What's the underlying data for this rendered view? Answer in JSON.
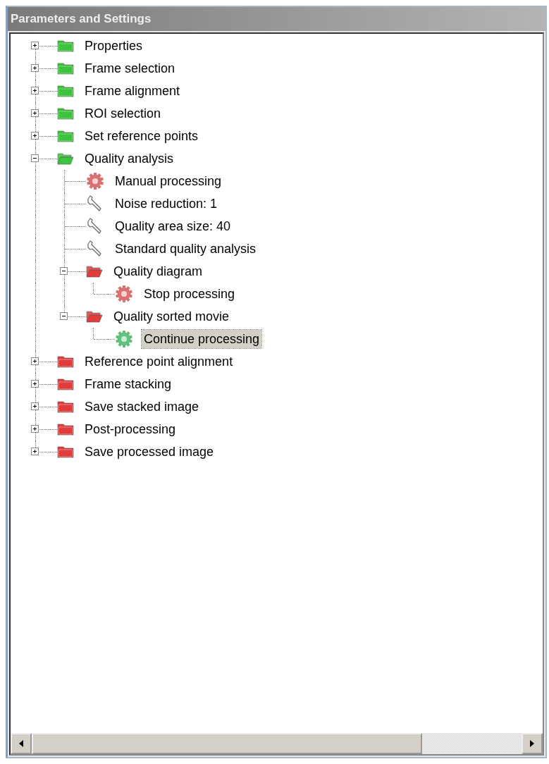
{
  "panel": {
    "title": "Parameters and Settings"
  },
  "nodes": [
    {
      "label": "Properties",
      "kind": "folder",
      "color": "#3cc43c",
      "expanded": false,
      "selected": false
    },
    {
      "label": "Frame selection",
      "kind": "folder",
      "color": "#3cc43c",
      "expanded": false,
      "selected": false
    },
    {
      "label": "Frame alignment",
      "kind": "folder",
      "color": "#3cc43c",
      "expanded": false,
      "selected": false
    },
    {
      "label": "ROI selection",
      "kind": "folder",
      "color": "#3cc43c",
      "expanded": false,
      "selected": false
    },
    {
      "label": "Set reference points",
      "kind": "folder",
      "color": "#3cc43c",
      "expanded": false,
      "selected": false
    },
    {
      "label": "Quality analysis",
      "kind": "folder",
      "color": "#3cc43c",
      "expanded": true,
      "selected": false,
      "children": [
        {
          "label": "Manual processing",
          "kind": "gear",
          "color": "#e07070",
          "selected": false
        },
        {
          "label": "Noise reduction: 1",
          "kind": "wrench",
          "selected": false
        },
        {
          "label": "Quality area size: 40",
          "kind": "wrench",
          "selected": false
        },
        {
          "label": "Standard quality analysis",
          "kind": "wrench",
          "selected": false
        },
        {
          "label": "Quality diagram",
          "kind": "folder",
          "color": "#e03c3c",
          "expanded": true,
          "selected": false,
          "children": [
            {
              "label": "Stop processing",
              "kind": "gear",
              "color": "#e07070",
              "selected": false
            }
          ]
        },
        {
          "label": "Quality sorted movie",
          "kind": "folder",
          "color": "#e03c3c",
          "expanded": true,
          "selected": false,
          "children": [
            {
              "label": "Continue processing",
              "kind": "gear",
              "color": "#5cc47c",
              "selected": true
            }
          ]
        }
      ]
    },
    {
      "label": "Reference point alignment",
      "kind": "folder",
      "color": "#e03c3c",
      "expanded": false,
      "selected": false
    },
    {
      "label": "Frame stacking",
      "kind": "folder",
      "color": "#e03c3c",
      "expanded": false,
      "selected": false
    },
    {
      "label": "Save stacked image",
      "kind": "folder",
      "color": "#e03c3c",
      "expanded": false,
      "selected": false
    },
    {
      "label": "Post-processing",
      "kind": "folder",
      "color": "#e03c3c",
      "expanded": false,
      "selected": false
    },
    {
      "label": "Save processed image",
      "kind": "folder",
      "color": "#e03c3c",
      "expanded": false,
      "selected": false
    }
  ]
}
